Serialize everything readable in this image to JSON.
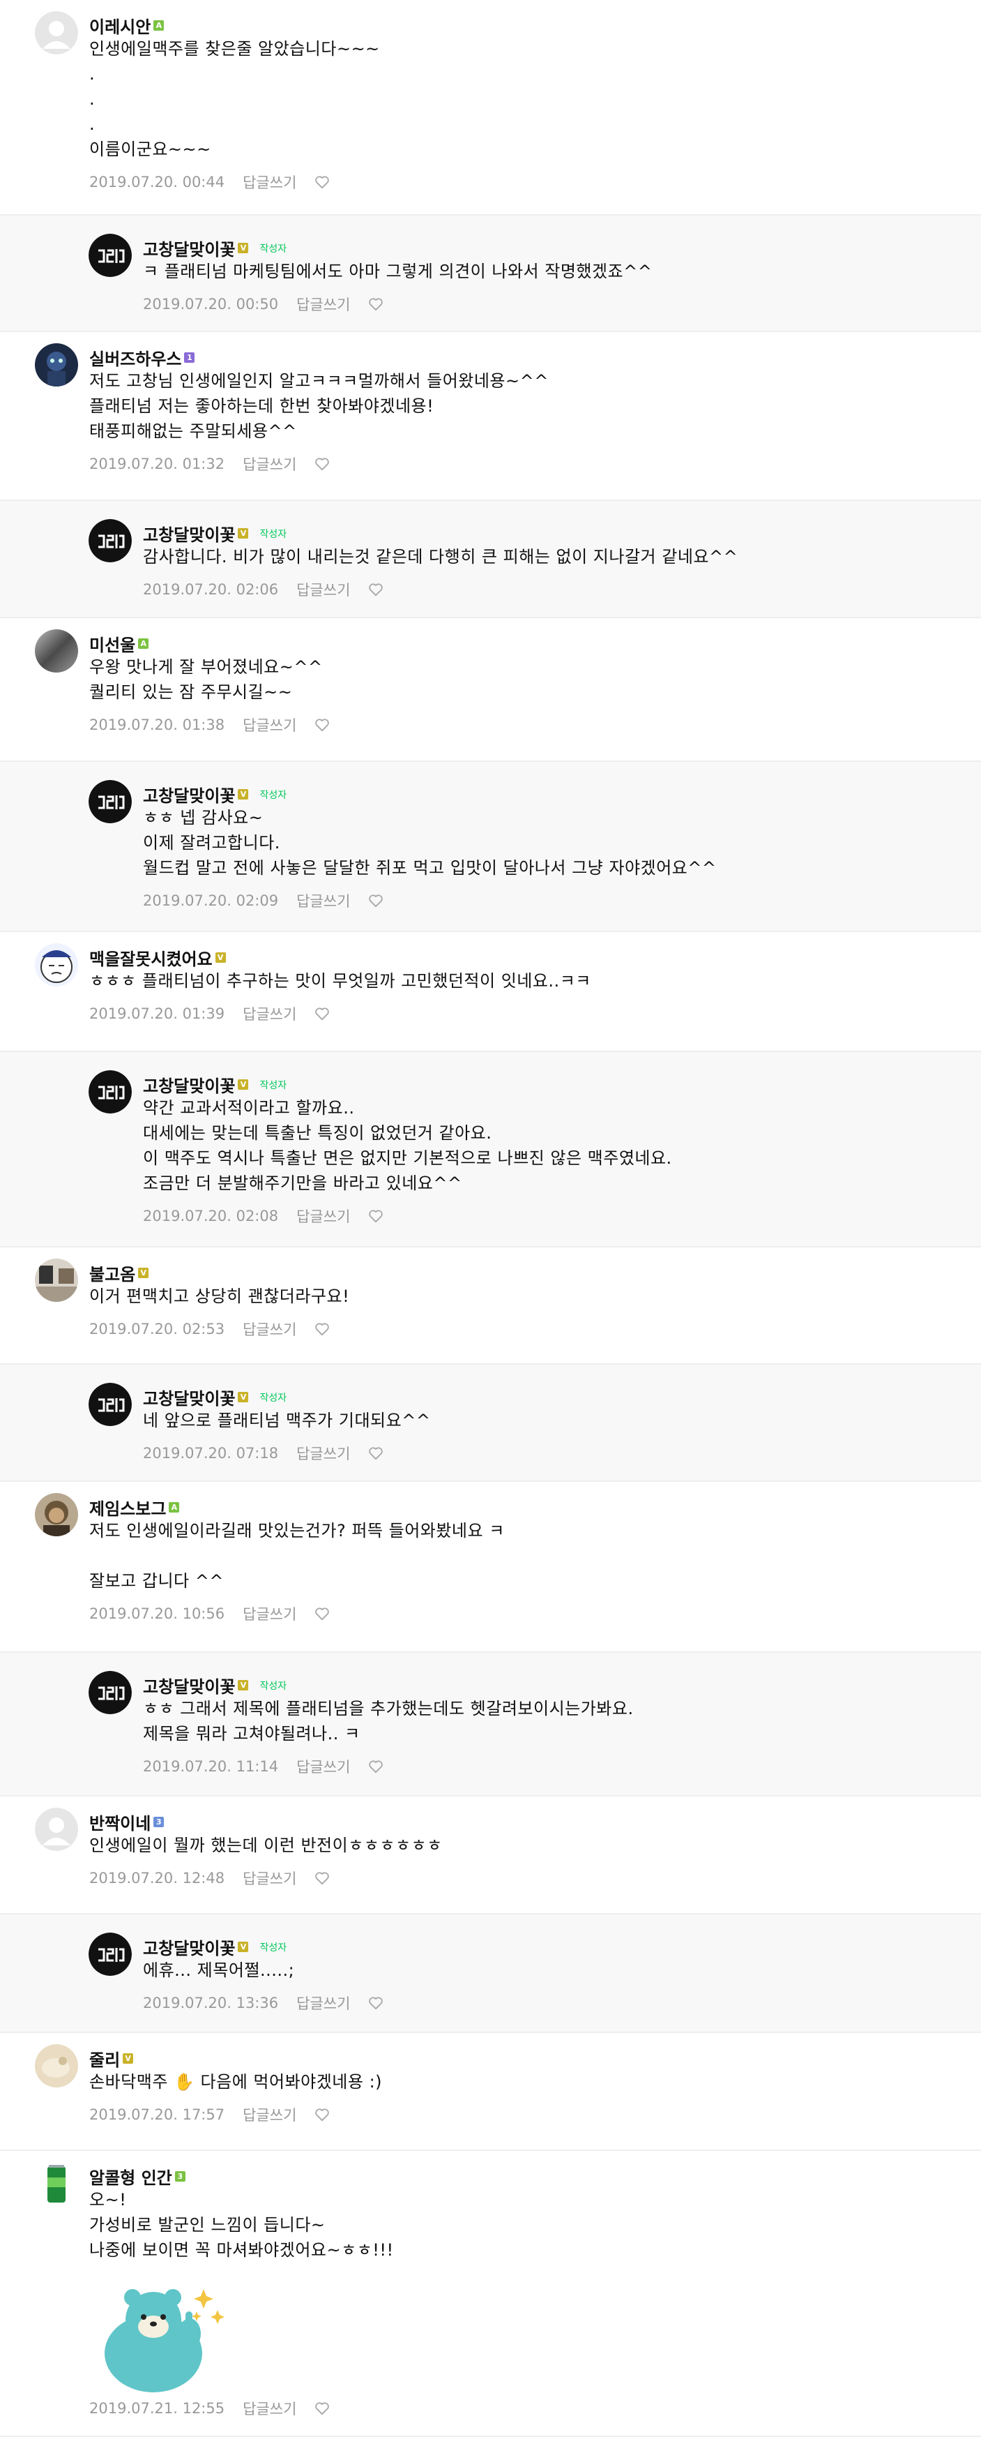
{
  "ui": {
    "reply_label": "답글쓰기",
    "writer_badge": "작성자"
  },
  "colors": {
    "level_green": "#7cc242",
    "level_purple": "#8a6bd6",
    "level_blue": "#6a8ed9",
    "level_yellow": "#c9b22a",
    "writer_green": "#03c75a",
    "reply_bg": "#f8f8f8",
    "meta_gray": "#999999"
  },
  "comments": [
    {
      "name": "이레시안",
      "level": "A",
      "level_color": "green",
      "is_reply": false,
      "avatar": "default-avatar",
      "text": "인생에일맥주를 찾은줄 알았습니다~~~\n.\n.\n.\n이름이군요~~~",
      "date": "2019.07.20. 00:44"
    },
    {
      "name": "고창달맞이꽃",
      "level": "V",
      "level_color": "yellow",
      "is_reply": true,
      "avatar": "brand-logo-avatar",
      "text": "ㅋ 플래티넘 마케팅팀에서도 아마 그렇게 의견이 나와서 작명했겠죠^^",
      "date": "2019.07.20. 00:50"
    },
    {
      "name": "실버즈하우스",
      "level": "1",
      "level_color": "purple",
      "is_reply": false,
      "avatar": "character-avatar",
      "text": "저도 고창님 인생에일인지 알고ㅋㅋㅋ멀까해서 들어왔네용~^^\n플래티넘 저는 좋아하는데 한번 찾아봐야겠네용!\n태풍피해없는 주말되세용^^",
      "date": "2019.07.20. 01:32"
    },
    {
      "name": "고창달맞이꽃",
      "level": "V",
      "level_color": "yellow",
      "is_reply": true,
      "avatar": "brand-logo-avatar",
      "text": "감사합니다. 비가 많이 내리는것 같은데 다행히 큰 피해는 없이 지나갈거 같네요^^",
      "date": "2019.07.20. 02:06"
    },
    {
      "name": "미선울",
      "level": "A",
      "level_color": "green",
      "is_reply": false,
      "avatar": "gray-photo-avatar",
      "text": "우왕 맛나게 잘 부어졌네요~^^\n퀄리티 있는 잠 주무시길~~",
      "date": "2019.07.20. 01:38"
    },
    {
      "name": "고창달맞이꽃",
      "level": "V",
      "level_color": "yellow",
      "is_reply": true,
      "avatar": "brand-logo-avatar",
      "text": "ㅎㅎ 넵 감사요~\n이제 잘려고합니다.\n월드컵 말고 전에 사놓은 달달한 쥐포 먹고 입맛이 달아나서 그냥 자야겠어요^^",
      "date": "2019.07.20. 02:09"
    },
    {
      "name": "맥을잘못시켰어요",
      "level": "V",
      "level_color": "yellow",
      "is_reply": false,
      "avatar": "cartoon-face-avatar",
      "text": "ㅎㅎㅎ 플래티넘이 추구하는 맛이 무엇일까 고민했던적이 잇네요..ㅋㅋ",
      "date": "2019.07.20. 01:39"
    },
    {
      "name": "고창달맞이꽃",
      "level": "V",
      "level_color": "yellow",
      "is_reply": true,
      "avatar": "brand-logo-avatar",
      "text": "약간 교과서적이라고 할까요..\n대세에는 맞는데 특출난 특징이 없었던거 같아요.\n이 맥주도 역시나 특출난 면은 없지만 기본적으로 나쁘진 않은 맥주였네요.\n조금만 더 분발해주기만을 바라고 있네요^^",
      "date": "2019.07.20. 02:08"
    },
    {
      "name": "불고옴",
      "level": "V",
      "level_color": "yellow",
      "is_reply": false,
      "avatar": "interior-photo-avatar",
      "text": "이거 편맥치고 상당히 괜찮더라구요!",
      "date": "2019.07.20. 02:53"
    },
    {
      "name": "고창달맞이꽃",
      "level": "V",
      "level_color": "yellow",
      "is_reply": true,
      "avatar": "brand-logo-avatar",
      "text": "네 앞으로 플래티넘 맥주가 기대되요^^",
      "date": "2019.07.20. 07:18"
    },
    {
      "name": "제임스보그",
      "level": "A",
      "level_color": "green",
      "is_reply": false,
      "avatar": "portrait-photo-avatar",
      "text": "저도 인생에일이라길래 맛있는건가? 퍼뜩 들어와봤네요 ㅋ\n\n잘보고 갑니다 ^^",
      "date": "2019.07.20. 10:56"
    },
    {
      "name": "고창달맞이꽃",
      "level": "V",
      "level_color": "yellow",
      "is_reply": true,
      "avatar": "brand-logo-avatar",
      "text": "ㅎㅎ 그래서 제목에 플래티넘을 추가했는데도 헷갈려보이시는가봐요.\n제목을 뭐라 고쳐야될려나.. ㅋ",
      "date": "2019.07.20. 11:14"
    },
    {
      "name": "반짝이네",
      "level": "3",
      "level_color": "blue",
      "is_reply": false,
      "avatar": "default-avatar",
      "text": "인생에일이 뭘까 했는데 이런 반전이ㅎㅎㅎㅎㅎㅎ",
      "date": "2019.07.20. 12:48"
    },
    {
      "name": "고창달맞이꽃",
      "level": "V",
      "level_color": "yellow",
      "is_reply": true,
      "avatar": "brand-logo-avatar",
      "text": "에휴... 제목어쩔.....;",
      "date": "2019.07.20. 13:36"
    },
    {
      "name": "줄리",
      "level": "V",
      "level_color": "yellow",
      "is_reply": false,
      "avatar": "beige-photo-avatar",
      "text": "손바닥맥주 ✋ 다음에 먹어봐야겠네용 :)",
      "date": "2019.07.20. 17:57"
    },
    {
      "name": "알콜형 인간",
      "level": "3",
      "level_color": "green",
      "is_reply": false,
      "avatar": "green-can-avatar",
      "text": "오~!\n가성비로 발군인 느낌이 듭니다~\n나중에 보이면 꼭 마셔봐야겠어요~ㅎㅎ!!!",
      "date": "2019.07.21. 12:55",
      "sticker": "bear-sticker"
    }
  ]
}
